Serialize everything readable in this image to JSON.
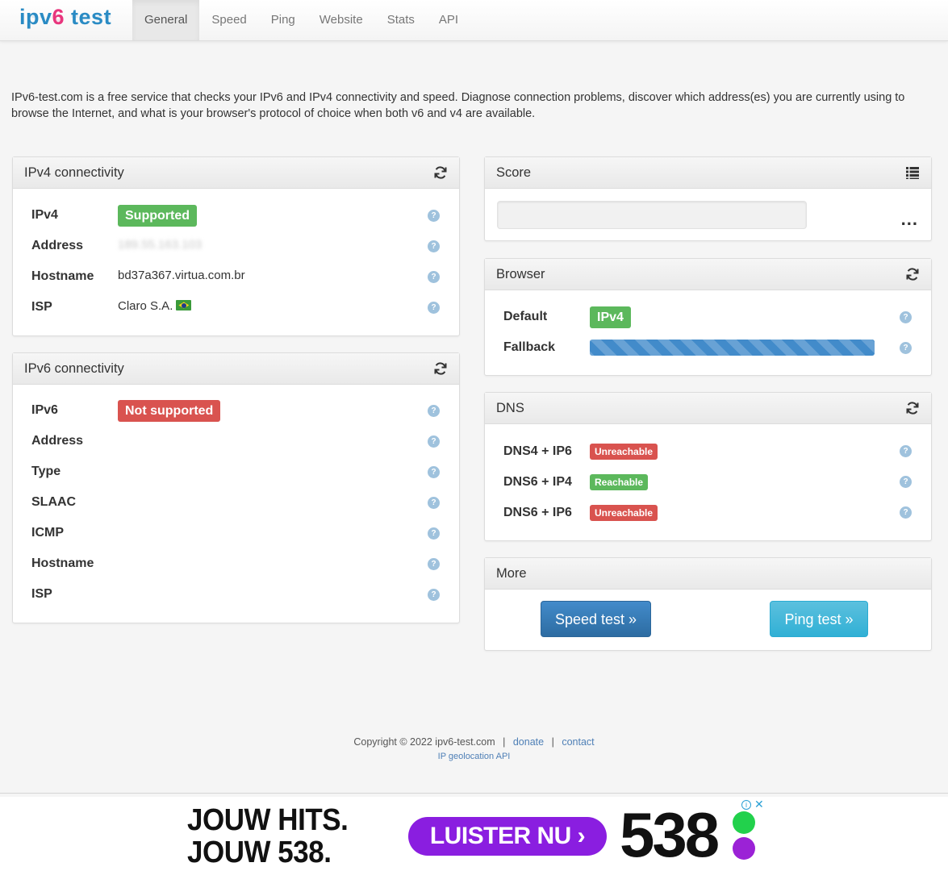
{
  "brand": {
    "prefix": "ipv",
    "six": "6",
    "suffix": " test"
  },
  "nav": [
    "General",
    "Speed",
    "Ping",
    "Website",
    "Stats",
    "API"
  ],
  "intro": "IPv6-test.com is a free service that checks your IPv6 and IPv4 connectivity and speed. Diagnose connection problems, discover which address(es) you are currently using to browse the Internet, and what is your browser's protocol of choice when both v6 and v4 are available.",
  "ipv4": {
    "title": "IPv4 connectivity",
    "rows": {
      "ipv4_label": "IPv4",
      "ipv4_status": "Supported",
      "address_label": "Address",
      "address_value": "189.55.163.103",
      "hostname_label": "Hostname",
      "hostname_value": "bd37a367.virtua.com.br",
      "isp_label": "ISP",
      "isp_value": "Claro S.A."
    }
  },
  "ipv6": {
    "title": "IPv6 connectivity",
    "rows": {
      "ipv6_label": "IPv6",
      "ipv6_status": "Not supported",
      "address_label": "Address",
      "type_label": "Type",
      "slaac_label": "SLAAC",
      "icmp_label": "ICMP",
      "hostname_label": "Hostname",
      "isp_label": "ISP"
    }
  },
  "score": {
    "title": "Score",
    "dots": "..."
  },
  "browser": {
    "title": "Browser",
    "default_label": "Default",
    "default_value": "IPv4",
    "fallback_label": "Fallback",
    "fallback_progress": 1.0
  },
  "dns": {
    "title": "DNS",
    "rows": [
      {
        "label": "DNS4 + IP6",
        "status": "Unreachable"
      },
      {
        "label": "DNS6 + IP4",
        "status": "Reachable"
      },
      {
        "label": "DNS6 + IP6",
        "status": "Unreachable"
      }
    ]
  },
  "more": {
    "title": "More",
    "speed_btn": "Speed test »",
    "ping_btn": "Ping test »"
  },
  "footer": {
    "copyright": "Copyright © 2022 ipv6-test.com",
    "sep": "|",
    "donate": "donate",
    "contact": "contact",
    "geo_api": "IP geolocation API"
  },
  "ad": {
    "line1": "JOUW HITS.",
    "line2": "JOUW 538.",
    "button": "LUISTER NU ›",
    "brand": "538",
    "info": "i",
    "close": "✕"
  },
  "colors": {
    "success": "#5cb85c",
    "danger": "#d9534f",
    "primary": "#428bca",
    "info": "#5bc0de",
    "brand_blue": "#2a8bc4",
    "brand_pink": "#e8357d"
  },
  "icons": {
    "refresh": "refresh-icon",
    "list": "list-icon",
    "help": "help-icon",
    "flag": "brazil-flag-icon"
  }
}
